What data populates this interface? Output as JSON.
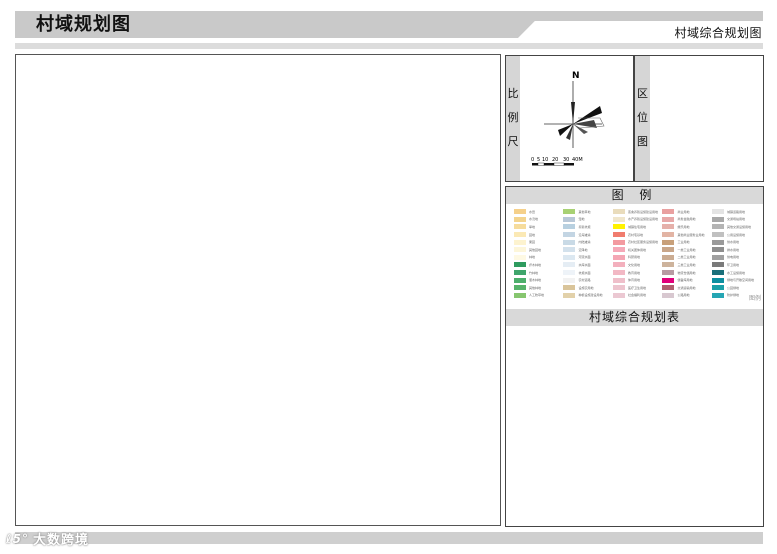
{
  "header": {
    "title": "村域规划图",
    "subtitle": "村域综合规划图"
  },
  "scale_panel": {
    "label_chars": [
      "比",
      "例",
      "尺"
    ],
    "north": "N",
    "scale_ticks": [
      "0",
      "5",
      "10",
      "20",
      "30",
      "40M"
    ]
  },
  "location_panel": {
    "label_chars": [
      "区",
      "位",
      "图"
    ]
  },
  "legend": {
    "title": "图 例",
    "marker": "图例",
    "items": [
      {
        "color": "#f5d08a",
        "label": "水田"
      },
      {
        "color": "#f3d48e",
        "label": "水浇地"
      },
      {
        "color": "#f6dc9c",
        "label": "旱地"
      },
      {
        "color": "#fbe9b5",
        "label": "园地"
      },
      {
        "color": "#fdf3cf",
        "label": "果园"
      },
      {
        "color": "#fdf6d9",
        "label": "其他园地"
      },
      {
        "color": "#fef9e3",
        "label": "林地"
      },
      {
        "color": "#2e9b5f",
        "label": "乔木林地"
      },
      {
        "color": "#3fa56b",
        "label": "竹林地"
      },
      {
        "color": "#4daf6c",
        "label": "灌木林地"
      },
      {
        "color": "#56b36a",
        "label": "其他林地"
      },
      {
        "color": "#87c66f",
        "label": "人工牧草地"
      },
      {
        "color": "#a8d174",
        "label": "其他草地"
      },
      {
        "color": "#b9c8d8",
        "label": "湿地"
      },
      {
        "color": "#b8d0e0",
        "label": "养殖坑塘"
      },
      {
        "color": "#c3d5e3",
        "label": "沿海滩涂"
      },
      {
        "color": "#c9dae6",
        "label": "内陆滩涂"
      },
      {
        "color": "#d3e1ec",
        "label": "沼泽地"
      },
      {
        "color": "#dce8f1",
        "label": "河流水面"
      },
      {
        "color": "#e5edf4",
        "label": "水库水面"
      },
      {
        "color": "#eef3f8",
        "label": "坑塘水面"
      },
      {
        "color": "#f2f2f2",
        "label": "农村道路"
      },
      {
        "color": "#d9c49a",
        "label": "设施农用地"
      },
      {
        "color": "#e2d1aa",
        "label": "种植设施建设用地"
      },
      {
        "color": "#e9dcbc",
        "label": "畜禽养殖设施建设用地"
      },
      {
        "color": "#f0e6cc",
        "label": "水产养殖设施建设用地"
      },
      {
        "color": "#fff200",
        "label": "城镇住宅用地"
      },
      {
        "color": "#f07c6e",
        "label": "农村宅基地"
      },
      {
        "color": "#f39aa0",
        "label": "农村社区服务设施用地"
      },
      {
        "color": "#f5a9b8",
        "label": "机关团体用地"
      },
      {
        "color": "#f4a6b4",
        "label": "科研用地"
      },
      {
        "color": "#f3b0bd",
        "label": "文化用地"
      },
      {
        "color": "#f2b8c4",
        "label": "教育用地"
      },
      {
        "color": "#efbfca",
        "label": "体育用地"
      },
      {
        "color": "#edc4ce",
        "label": "医疗卫生用地"
      },
      {
        "color": "#ebc8d2",
        "label": "社会福利用地"
      },
      {
        "color": "#e9a0a0",
        "label": "商业用地"
      },
      {
        "color": "#e7a8a8",
        "label": "商务金融用地"
      },
      {
        "color": "#e5b0aa",
        "label": "娱乐用地"
      },
      {
        "color": "#e2b4a4",
        "label": "其他商业服务业用地"
      },
      {
        "color": "#c8a07a",
        "label": "工业用地"
      },
      {
        "color": "#c9a689",
        "label": "一类工业用地"
      },
      {
        "color": "#cbac92",
        "label": "二类工业用地"
      },
      {
        "color": "#cdb39c",
        "label": "三类工业用地"
      },
      {
        "color": "#b79ba2",
        "label": "物流仓储用地"
      },
      {
        "color": "#e0007a",
        "label": "储备库用地"
      },
      {
        "color": "#b06070",
        "label": "交通运输用地"
      },
      {
        "color": "#d8c8d0",
        "label": "公路用地"
      },
      {
        "color": "#e4e4e4",
        "label": "城镇道路用地"
      },
      {
        "color": "#a8a8a8",
        "label": "交通场站用地"
      },
      {
        "color": "#b4b4b4",
        "label": "其他交通设施用地"
      },
      {
        "color": "#c0c0c0",
        "label": "公用设施用地"
      },
      {
        "color": "#9a9a9a",
        "label": "供水用地"
      },
      {
        "color": "#8e8e8e",
        "label": "排水用地"
      },
      {
        "color": "#a0a0a0",
        "label": "供电用地"
      },
      {
        "color": "#7a7a7a",
        "label": "环卫用地"
      },
      {
        "color": "#1a6f7a",
        "label": "水工设施用地"
      },
      {
        "color": "#0d8fa0",
        "label": "绿地与开敞空间用地"
      },
      {
        "color": "#1aa0a8",
        "label": "公园绿地"
      },
      {
        "color": "#26a6b4",
        "label": "防护绿地"
      }
    ]
  },
  "summary_table": {
    "title": "村域综合规划表"
  },
  "footer": {
    "watermark_logo": "ℓ5°",
    "watermark_text": "大数跨境"
  }
}
